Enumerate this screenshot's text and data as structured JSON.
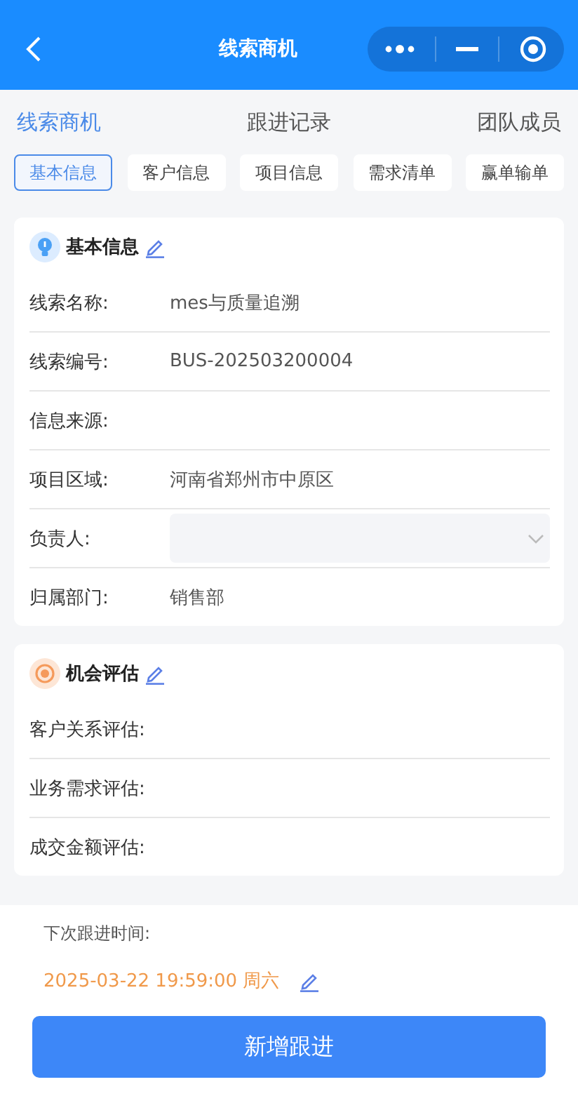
{
  "window": {
    "title": "线索商机"
  },
  "main_tabs": [
    {
      "label": "线索商机",
      "selected": true
    },
    {
      "label": "跟进记录",
      "selected": false
    },
    {
      "label": "团队成员",
      "selected": false
    }
  ],
  "sub_tabs": [
    {
      "label": "基本信息",
      "selected": true
    },
    {
      "label": "客户信息",
      "selected": false
    },
    {
      "label": "项目信息",
      "selected": false
    },
    {
      "label": "需求清单",
      "selected": false
    },
    {
      "label": "赢单输单",
      "selected": false
    }
  ],
  "sections": [
    {
      "title": "基本信息",
      "kind": "info",
      "fields": [
        {
          "label": "线索名称:",
          "value": "mes与质量追溯",
          "kind": "text"
        },
        {
          "label": "线索编号:",
          "value": "BUS-202503200004",
          "kind": "text"
        },
        {
          "label": "信息来源:",
          "kind": "text"
        },
        {
          "label": "项目区域:",
          "value": "河南省郑州市中原区",
          "kind": "text"
        },
        {
          "label": "负责人:",
          "kind": "select"
        },
        {
          "label": "归属部门:",
          "value": "销售部",
          "kind": "text"
        }
      ]
    },
    {
      "title": "机会评估",
      "kind": "target",
      "fields": [
        {
          "label": "客户关系评估:",
          "kind": "text"
        },
        {
          "label": "业务需求评估:",
          "kind": "text"
        },
        {
          "label": "成交金额评估:",
          "kind": "text"
        }
      ]
    }
  ],
  "next_follow_up": {
    "label": "下次跟进时间:",
    "value": "2025-03-22 19:59:00 周六"
  },
  "primary_button": "新增跟进"
}
